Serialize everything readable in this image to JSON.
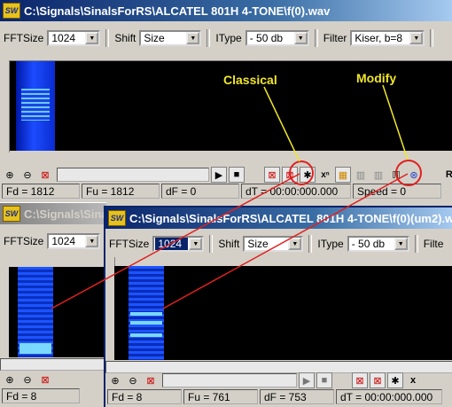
{
  "window_top": {
    "title": "C:\\Signals\\SinalsForRS\\ALCATEL 801H 4-TONE\\f(0).wav",
    "fftsize_label": "FFTSize",
    "fftsize_value": "1024",
    "shift_label": "Shift",
    "shift_value": "Size",
    "itype_label": "IType",
    "itype_value": "- 50 db",
    "filter_label": "Filter",
    "filter_value": "Kiser, b=8",
    "status": {
      "fd": "Fd = 1812",
      "fu": "Fu = 1812",
      "df": "dF = 0",
      "dt": "dT = 00:00:000.000",
      "speed": "Speed = 0"
    },
    "toolbar": {
      "xn": "xⁿ",
      "r": "R="
    }
  },
  "window_back": {
    "title": "C:\\Signals\\SinalsForRS",
    "fftsize_label": "FFTSize",
    "fftsize_value": "1024",
    "status": {
      "fd": "Fd = 8"
    }
  },
  "window_front": {
    "title": "C:\\Signals\\SinalsForRS\\ALCATEL 801H 4-TONE\\f(0)(um2).wav",
    "fftsize_label": "FFTSize",
    "fftsize_value": "1024",
    "shift_label": "Shift",
    "shift_value": "Size",
    "itype_label": "IType",
    "itype_value": "- 50 db",
    "filter_label": "Filte",
    "status": {
      "fd": "Fd = 8",
      "fu": "Fu = 761",
      "df": "dF = 753",
      "dt": "dT = 00:00:000.000"
    }
  },
  "annotations": {
    "classical": "Classical",
    "modify": "Modify"
  },
  "colors": {
    "annotation_text": "#f0e62a",
    "callout": "#e02020",
    "active_title": "#0a246a"
  }
}
